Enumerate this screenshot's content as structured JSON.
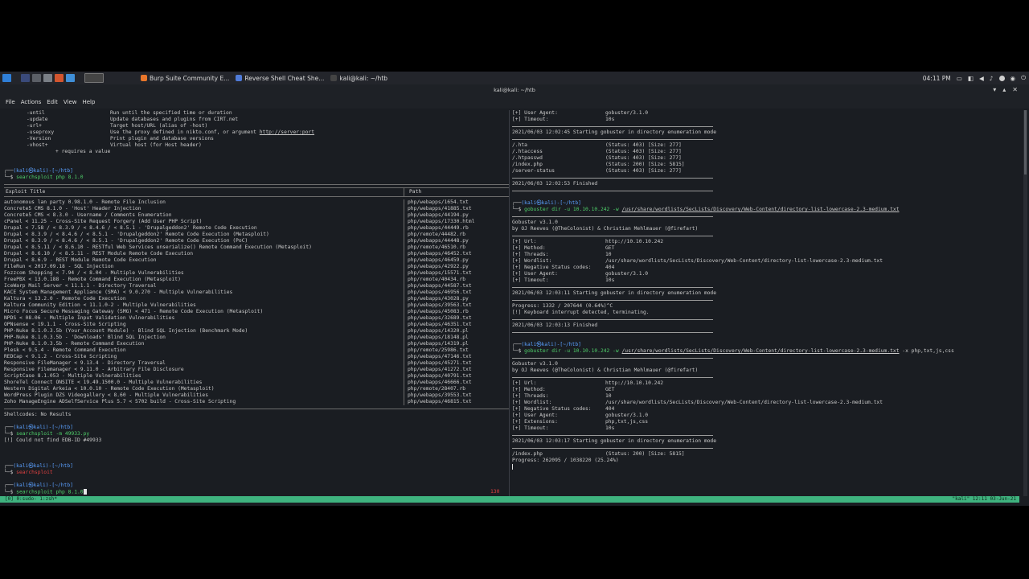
{
  "taskbar": {
    "tasks": [
      {
        "label": "Burp Suite Community E...",
        "color": "#e8762b"
      },
      {
        "label": "Reverse Shell Cheat She...",
        "color": "#4f7bd8"
      },
      {
        "label": "kali@kali: ~/htb",
        "color": "#444444"
      }
    ],
    "clock": "04:11 PM"
  },
  "window": {
    "title": "kali@kali: ~/htb"
  },
  "menu": [
    "File",
    "Actions",
    "Edit",
    "View",
    "Help"
  ],
  "left": {
    "help_lines": [
      {
        "opt": "-until",
        "desc": "Run until the specified time or duration"
      },
      {
        "opt": "-update",
        "desc": "Update databases and plugins from CIRT.net"
      },
      {
        "opt": "-url+",
        "desc": "Target host/URL (alias of -host)"
      },
      {
        "opt": "-useproxy",
        "desc": "Use the proxy defined in nikto.conf, or argument ",
        "link": "http://server:port"
      },
      {
        "opt": "-Version",
        "desc": "Print plugin and database versions"
      },
      {
        "opt": "-vhost+",
        "desc": "Virtual host (for Host header)"
      }
    ],
    "help_footer": "+ requires a value",
    "prompt_user": "(kali㉿kali)-[~/htb]",
    "cmd1": "searchsploit php 8.1.0",
    "col_title": "Exploit Title",
    "col_path": "Path",
    "exploits": [
      [
        "autonomous lan party 0.98.1.0 - Remote File Inclusion",
        "php/webapps/1654.txt"
      ],
      [
        "Concrete5 CMS 8.1.0 - 'Host' Header Injection",
        "php/webapps/41885.txt"
      ],
      [
        "Concrete5 CMS < 8.3.0 - Username / Comments Enumeration",
        "php/webapps/44194.py"
      ],
      [
        "cPanel < 11.25 - Cross-Site Request Forgery (Add User PHP Script)",
        "php/webapps/17330.html"
      ],
      [
        "Drupal < 7.58 / < 8.3.9 / < 8.4.6 / < 8.5.1 - 'Drupalgeddon2' Remote Code Execution",
        "php/webapps/44449.rb"
      ],
      [
        "Drupal < 8.3.9 / < 8.4.6 / < 8.5.1 - 'Drupalgeddon2' Remote Code Execution (Metasploit)",
        "php/remote/44482.rb"
      ],
      [
        "Drupal < 8.3.9 / < 8.4.6 / < 8.5.1 - 'Drupalgeddon2' Remote Code Execution (PoC)",
        "php/webapps/44448.py"
      ],
      [
        "Drupal < 8.5.11 / < 8.6.10 - RESTful Web Services unserialize() Remote Command Execution (Metasploit)",
        "php/remote/46510.rb"
      ],
      [
        "Drupal < 8.6.10 / < 8.5.11 - REST Module Remote Code Execution",
        "php/webapps/46452.txt"
      ],
      [
        "Drupal < 8.6.9 - REST Module Remote Code Execution",
        "php/webapps/46459.py"
      ],
      [
        "FileRun < 2017.09.18 - SQL Injection",
        "php/webapps/42922.py"
      ],
      [
        "Fozzcom Shopping < 7.94 / < 8.04 - Multiple Vulnerabilities",
        "php/webapps/15571.txt"
      ],
      [
        "FreePBX < 13.0.188 - Remote Command Execution (Metasploit)",
        "php/remote/40434.rb"
      ],
      [
        "IceWarp Mail Server < 11.1.1 - Directory Traversal",
        "php/webapps/44587.txt"
      ],
      [
        "KACE System Management Appliance (SMA) < 9.0.270 - Multiple Vulnerabilities",
        "php/webapps/46956.txt"
      ],
      [
        "Kaltura < 13.2.0 - Remote Code Execution",
        "php/webapps/43028.py"
      ],
      [
        "Kaltura Community Edition < 11.1.0-2 - Multiple Vulnerabilities",
        "php/webapps/39563.txt"
      ],
      [
        "Micro Focus Secure Messaging Gateway (SMG) < 471 - Remote Code Execution (Metasploit)",
        "php/webapps/45083.rb"
      ],
      [
        "NPDS < 08.06 - Multiple Input Validation Vulnerabilities",
        "php/webapps/32689.txt"
      ],
      [
        "OPNsense < 19.1.1 - Cross-Site Scripting",
        "php/webapps/46351.txt"
      ],
      [
        "PHP-Nuke 8.1.0.3.5b (Your_Account Module) - Blind SQL Injection (Benchmark Mode)",
        "php/webapps/14320.pl"
      ],
      [
        "PHP-Nuke 8.1.0.3.5b - 'Downloads' Blind SQL Injection",
        "php/webapps/18148.pl"
      ],
      [
        "PHP-Nuke 8.1.0.3.5b - Remote Command Execution",
        "php/webapps/14319.pl"
      ],
      [
        "Plesk < 9.5.4 - Remote Command Execution",
        "php/remote/25986.txt"
      ],
      [
        "REDCap < 9.1.2 - Cross-Site Scripting",
        "php/webapps/47146.txt"
      ],
      [
        "Responsive FileManager < 9.13.4 - Directory Traversal",
        "php/webapps/45271.txt"
      ],
      [
        "Responsive Filemanager < 9.11.0 - Arbitrary File Disclosure",
        "php/webapps/41272.txt"
      ],
      [
        "ScriptCase 8.1.053 - Multiple Vulnerabilities",
        "php/webapps/40791.txt"
      ],
      [
        "ShoreTel Connect ONSITE < 19.49.1500.0 - Multiple Vulnerabilities",
        "php/webapps/46666.txt"
      ],
      [
        "Western Digital Arkeia < 10.0.10 - Remote Code Execution (Metasploit)",
        "php/remote/28407.rb"
      ],
      [
        "WordPress Plugin DZS Videogallery < 8.60 - Multiple Vulnerabilities",
        "php/webapps/39553.txt"
      ],
      [
        "Zoho ManageEngine ADSelfService Plus 5.7 < 5702 build - Cross-Site Scripting",
        "php/webapps/46815.txt"
      ]
    ],
    "shellcodes": "Shellcodes: No Results",
    "cmd2": "searchsploit -m 49933.py",
    "cmd2_result": "[!] Could not find EDB-ID #49933",
    "cmd3": "searchsploit",
    "cmd4": "searchsploit php 8.1.0",
    "exit_code": "130"
  },
  "right": {
    "top_lines": [
      {
        "k": "[+] User Agent:",
        "v": "gobuster/3.1.0"
      },
      {
        "k": "[+] Timeout:",
        "v": "10s"
      }
    ],
    "start1": "2021/06/03 12:02:45 Starting gobuster in directory enumeration mode",
    "results1": [
      {
        "k": "/.hta",
        "v": "(Status: 403) [Size: 277]"
      },
      {
        "k": "/.htaccess",
        "v": "(Status: 403) [Size: 277]"
      },
      {
        "k": "/.htpasswd",
        "v": "(Status: 403) [Size: 277]"
      },
      {
        "k": "/index.php",
        "v": "(Status: 200) [Size: 5815]"
      },
      {
        "k": "/server-status",
        "v": "(Status: 403) [Size: 277]"
      }
    ],
    "finished1": "2021/06/03 12:02:53 Finished",
    "prompt_user": "(kali㉿kali)-[~/htb]",
    "cmd_a": "gobuster dir -u 10.10.10.242 -w ",
    "wordlist": "/usr/share/wordlists/SecLists/Discovery/Web-Content/directory-list-lowercase-2.3-medium.txt",
    "banner1": "Gobuster v3.1.0",
    "banner2": "by OJ Reeves (@TheColonist) & Christian Mehlmauer (@firefart)",
    "config_a": [
      {
        "k": "[+] Url:",
        "v": "http://10.10.10.242"
      },
      {
        "k": "[+] Method:",
        "v": "GET"
      },
      {
        "k": "[+] Threads:",
        "v": "10"
      },
      {
        "k": "[+] Wordlist:",
        "v": "/usr/share/wordlists/SecLists/Discovery/Web-Content/directory-list-lowercase-2.3-medium.txt"
      },
      {
        "k": "[+] Negative Status codes:",
        "v": "404"
      },
      {
        "k": "[+] User Agent:",
        "v": "gobuster/3.1.0"
      },
      {
        "k": "[+] Timeout:",
        "v": "10s"
      }
    ],
    "start2": "2021/06/03 12:03:11 Starting gobuster in directory enumeration mode",
    "progress2": "Progress: 1332 / 207644 (0.64%)^C",
    "interrupt": "[!] Keyboard interrupt detected, terminating.",
    "finished2": "2021/06/03 12:03:13 Finished",
    "cmd_b_suffix": " -x php,txt,js,css",
    "config_b": [
      {
        "k": "[+] Url:",
        "v": "http://10.10.10.242"
      },
      {
        "k": "[+] Method:",
        "v": "GET"
      },
      {
        "k": "[+] Threads:",
        "v": "10"
      },
      {
        "k": "[+] Wordlist:",
        "v": "/usr/share/wordlists/SecLists/Discovery/Web-Content/directory-list-lowercase-2.3-medium.txt"
      },
      {
        "k": "[+] Negative Status codes:",
        "v": "404"
      },
      {
        "k": "[+] User Agent:",
        "v": "gobuster/3.1.0"
      },
      {
        "k": "[+] Extensions:",
        "v": "php,txt,js,css"
      },
      {
        "k": "[+] Timeout:",
        "v": "10s"
      }
    ],
    "start3": "2021/06/03 12:03:17 Starting gobuster in directory enumeration mode",
    "result3": {
      "k": "/index.php",
      "v": "(Status: 200) [Size: 5815]"
    },
    "progress3": "Progress: 262095 / 1038220 (25.24%)"
  },
  "status": {
    "left": "[0] 0:sudo- 1:zsh*",
    "right": "\"kali\" 12:11 03-Jun-21"
  },
  "colors": {
    "accent_green": "#3fb37f",
    "prompt_blue": "#5aa0ff",
    "highlight_red": "#e04040"
  }
}
